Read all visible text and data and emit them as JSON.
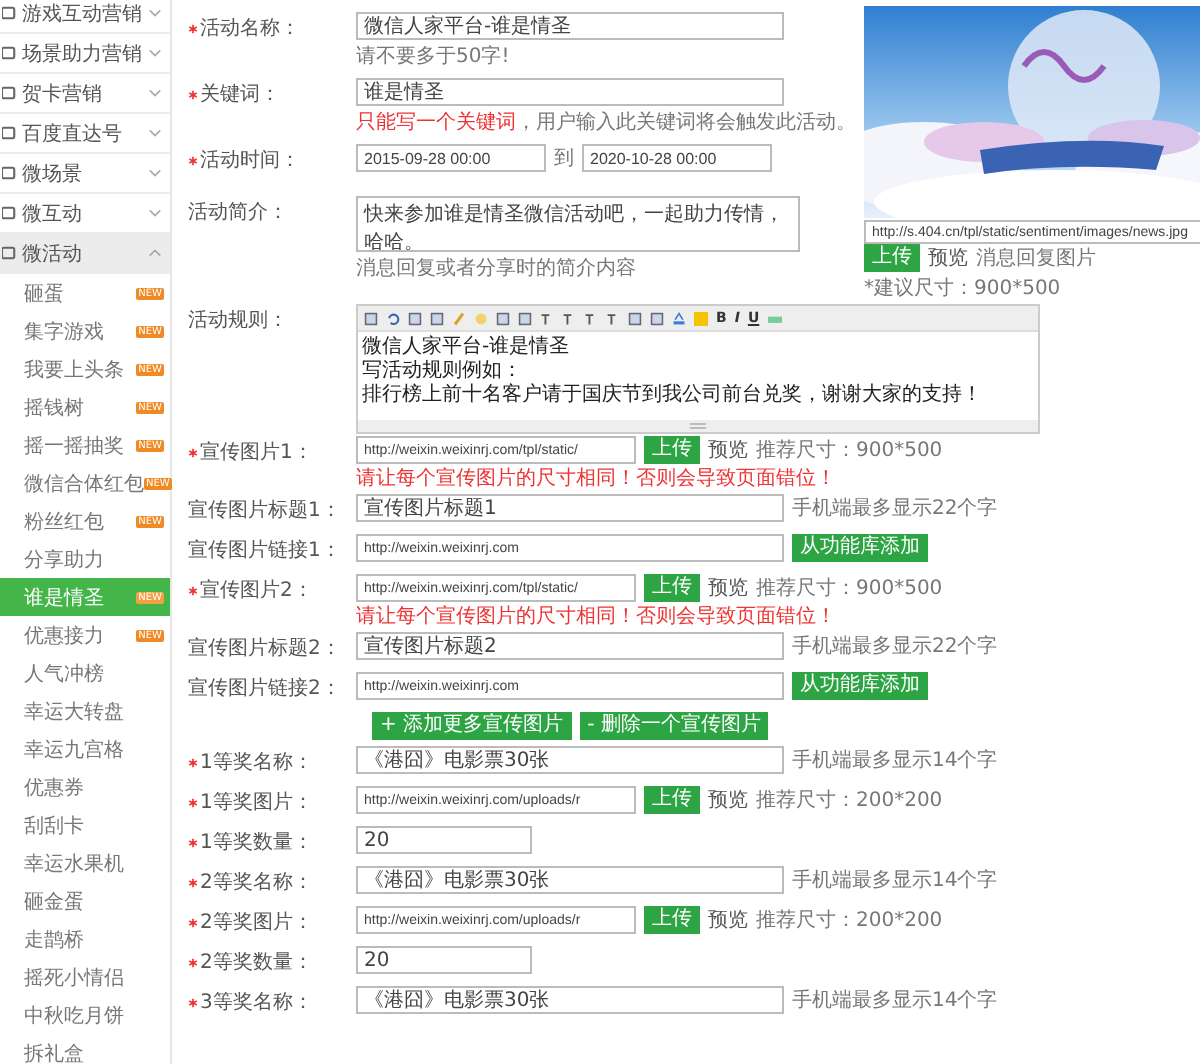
{
  "sidebar": {
    "sections": [
      {
        "label": "游戏互动营销",
        "expanded": false
      },
      {
        "label": "场景助力营销",
        "expanded": false
      },
      {
        "label": "贺卡营销",
        "expanded": false
      },
      {
        "label": "百度直达号",
        "expanded": false
      },
      {
        "label": "微场景",
        "expanded": false
      },
      {
        "label": "微互动",
        "expanded": false
      },
      {
        "label": "微活动",
        "expanded": true,
        "children": [
          {
            "label": "砸蛋",
            "badge": "NEW",
            "selected": false
          },
          {
            "label": "集字游戏",
            "badge": "NEW",
            "selected": false
          },
          {
            "label": "我要上头条",
            "badge": "NEW",
            "selected": false
          },
          {
            "label": "摇钱树",
            "badge": "NEW",
            "selected": false
          },
          {
            "label": "摇一摇抽奖",
            "badge": "NEW",
            "selected": false
          },
          {
            "label": "微信合体红包",
            "badge": "NEW",
            "selected": false
          },
          {
            "label": "粉丝红包",
            "badge": "NEW",
            "selected": false
          },
          {
            "label": "分享助力",
            "selected": false
          },
          {
            "label": "谁是情圣",
            "badge": "NEW",
            "selected": true
          },
          {
            "label": "优惠接力",
            "badge": "NEW",
            "selected": false
          },
          {
            "label": "人气冲榜",
            "selected": false
          },
          {
            "label": "幸运大转盘",
            "selected": false
          },
          {
            "label": "幸运九宫格",
            "selected": false
          },
          {
            "label": "优惠券",
            "selected": false
          },
          {
            "label": "刮刮卡",
            "selected": false
          },
          {
            "label": "幸运水果机",
            "selected": false
          },
          {
            "label": "砸金蛋",
            "selected": false
          },
          {
            "label": "走鹊桥",
            "selected": false
          },
          {
            "label": "摇死小情侣",
            "selected": false
          },
          {
            "label": "中秋吃月饼",
            "selected": false
          },
          {
            "label": "拆礼盒",
            "selected": false
          }
        ]
      }
    ]
  },
  "top_fields": [
    {
      "kind": "text",
      "label": "活动名称：",
      "required": true,
      "value": "微信人家平台-谁是情圣",
      "hint": "请不要多于50字!"
    },
    {
      "kind": "text",
      "label": "关键词：",
      "required": true,
      "value": "谁是情圣",
      "warning": "只能写一个关键词",
      "hint": "，用户输入此关键词将会触发此活动。"
    },
    {
      "kind": "daterange",
      "label": "活动时间：",
      "required": true,
      "start": "2015-09-28 00:00",
      "separator": "到",
      "end": "2020-10-28 00:00"
    },
    {
      "kind": "textarea",
      "label": "活动简介：",
      "required": false,
      "value": "快来参加谁是情圣微信活动吧，一起助力传情，哈哈。",
      "hint": "消息回复或者分享时的简介内容"
    }
  ],
  "cover": {
    "kind": "picture",
    "url": "http://s.404.cn/tpl/static/sentiment/images/news.jpg",
    "upload": "上传",
    "preview": "预览",
    "hint": "消息回复图片",
    "size_note": "*建议尺寸：900*500"
  },
  "rules": {
    "label": "活动规则：",
    "format_buttons": [
      "B",
      "I",
      "U"
    ],
    "lines": [
      "微信人家平台-谁是情圣",
      "写活动规则例如：",
      "排行榜上前十名客户请于国庆节到我公司前台兑奖，谢谢大家的支持！"
    ]
  },
  "banners": [
    {
      "image_label": "宣传图片1：",
      "required": true,
      "url": "http://weixin.weixinrj.com/tpl/static/",
      "upload": "上传",
      "preview": "预览",
      "size": "推荐尺寸：900*500",
      "warning": "请让每个宣传图片的尺寸相同！否则会导致页面错位！",
      "title_label": "宣传图片标题1：",
      "title": "宣传图片标题1",
      "title_hint": "手机端最多显示22个字",
      "link_label": "宣传图片链接1：",
      "link": "http://weixin.weixinrj.com",
      "library": "从功能库添加"
    },
    {
      "image_label": "宣传图片2：",
      "required": true,
      "url": "http://weixin.weixinrj.com/tpl/static/",
      "upload": "上传",
      "preview": "预览",
      "size": "推荐尺寸：900*500",
      "warning": "请让每个宣传图片的尺寸相同！否则会导致页面错位！",
      "title_label": "宣传图片标题2：",
      "title": "宣传图片标题2",
      "title_hint": "手机端最多显示22个字",
      "link_label": "宣传图片链接2：",
      "link": "http://weixin.weixinrj.com",
      "library": "从功能库添加"
    }
  ],
  "banner_actions": [
    "+ 添加更多宣传图片",
    "- 删除一个宣传图片"
  ],
  "prizes": [
    {
      "kind": "text",
      "label": "1等奖名称：",
      "required": true,
      "value": "《港囧》电影票30张",
      "hint": "手机端最多显示14个字"
    },
    {
      "label": "1等奖图片：",
      "required": true,
      "value": "http://weixin.weixinrj.com/uploads/r",
      "upload": "上传",
      "preview": "预览",
      "hint": "推荐尺寸：200*200"
    },
    {
      "kind": "number",
      "label": "1等奖数量：",
      "required": true,
      "value": "20"
    },
    {
      "kind": "text",
      "label": "2等奖名称：",
      "required": true,
      "value": "《港囧》电影票30张",
      "hint": "手机端最多显示14个字"
    },
    {
      "label": "2等奖图片：",
      "required": true,
      "value": "http://weixin.weixinrj.com/uploads/r",
      "upload": "上传",
      "preview": "预览",
      "hint": "推荐尺寸：200*200"
    },
    {
      "kind": "number",
      "label": "2等奖数量：",
      "required": true,
      "value": "20"
    },
    {
      "kind": "text",
      "label": "3等奖名称：",
      "required": true,
      "value": "《港囧》电影票30张",
      "hint": "手机端最多显示14个字"
    }
  ]
}
